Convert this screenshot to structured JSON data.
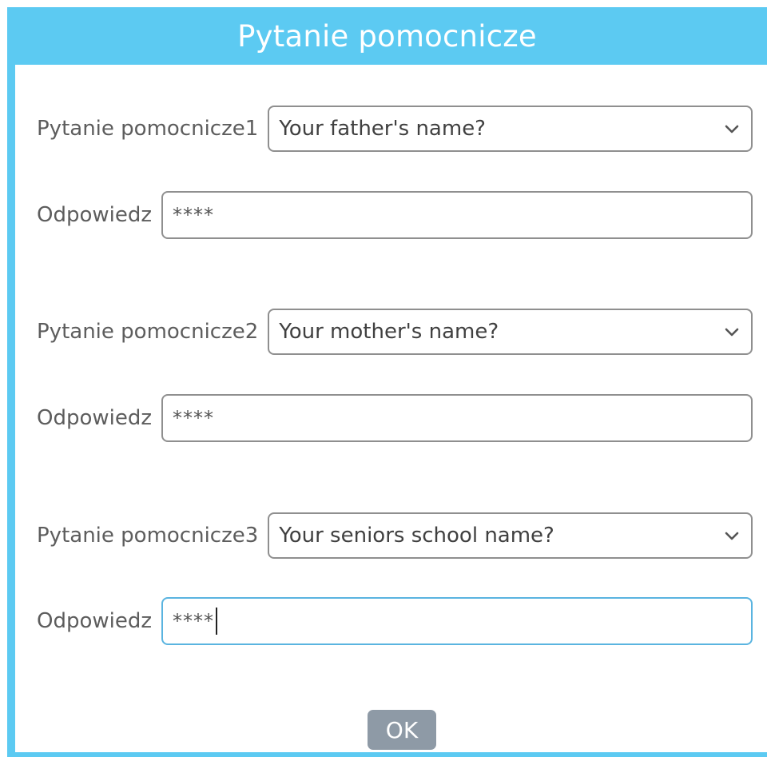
{
  "dialog": {
    "title": "Pytanie pomocnicze",
    "ok_label": "OK"
  },
  "questions": [
    {
      "label": "Pytanie pomocnicze1",
      "selected": "Your father's name?",
      "answer_label": "Odpowiedz",
      "answer_value": "****"
    },
    {
      "label": "Pytanie pomocnicze2",
      "selected": "Your mother's name?",
      "answer_label": "Odpowiedz",
      "answer_value": "****"
    },
    {
      "label": "Pytanie pomocnicze3",
      "selected": "Your seniors school name?",
      "answer_label": "Odpowiedz",
      "answer_value": "****"
    }
  ],
  "colors": {
    "titlebar": "#5ccaf2",
    "ok_button": "#8e9aa6",
    "focus_border": "#5ab4e0"
  },
  "icons": {
    "dropdown": "chevron-down-icon"
  }
}
